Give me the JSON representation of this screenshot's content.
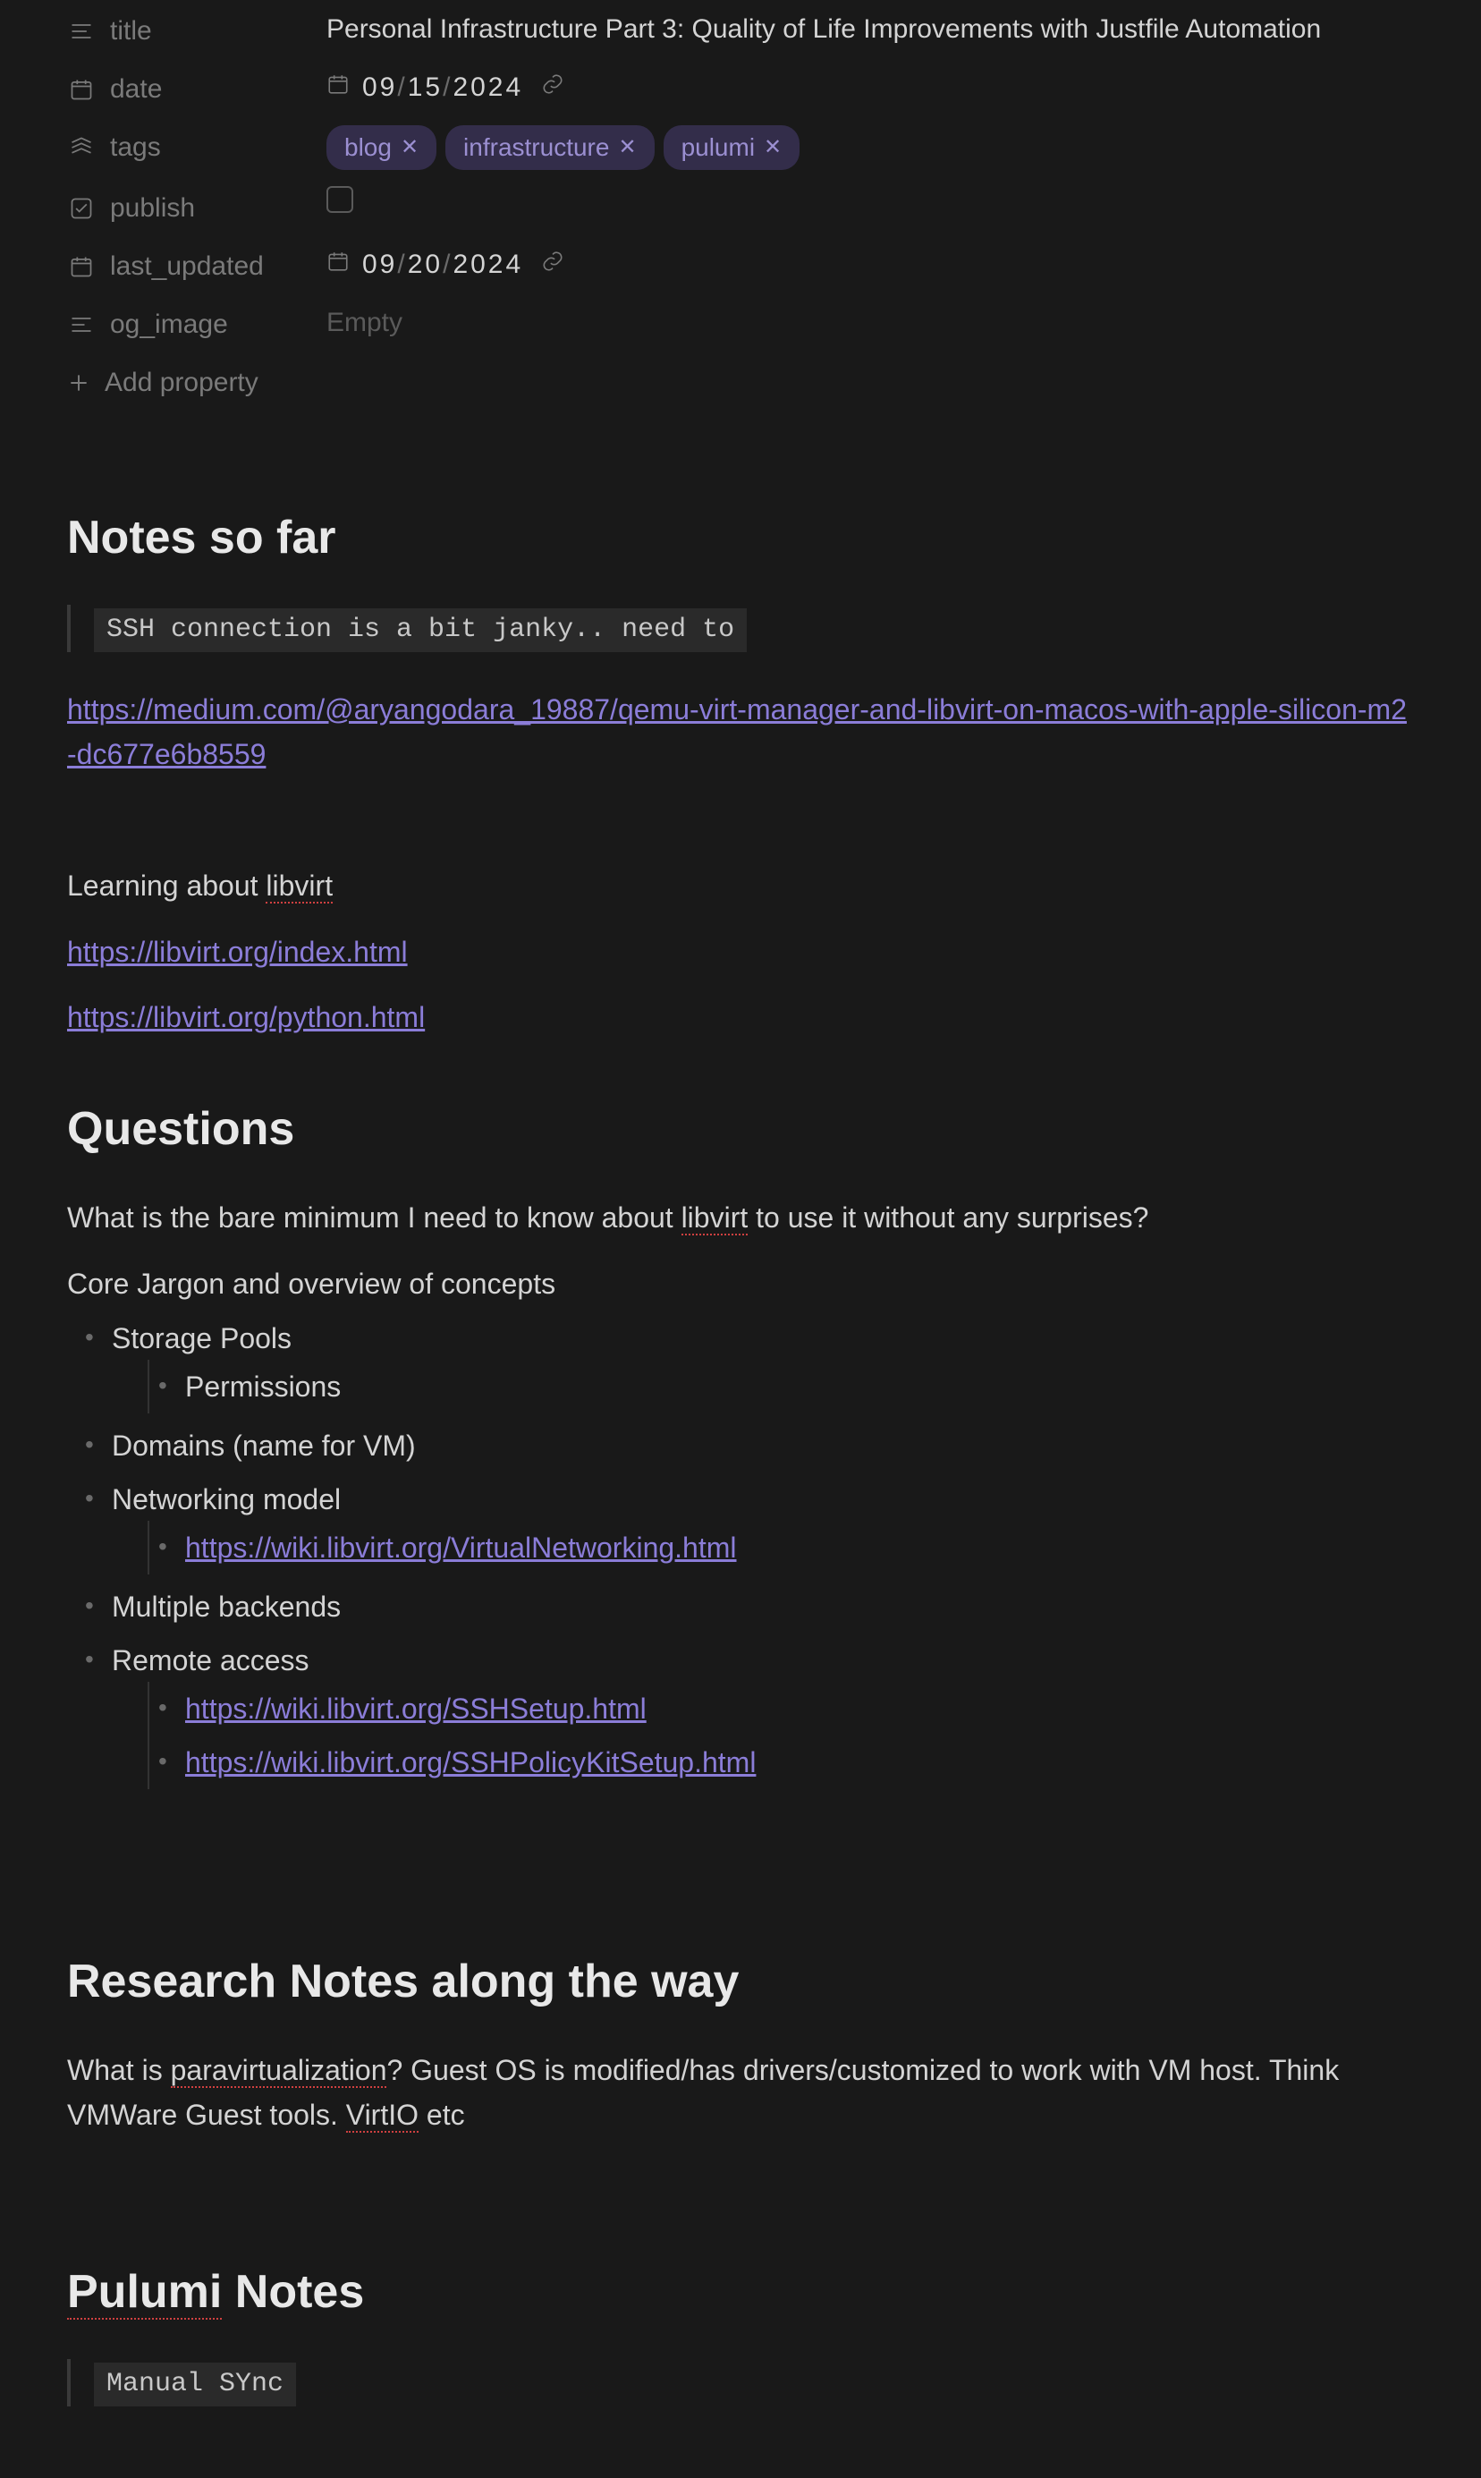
{
  "properties": {
    "title": {
      "label": "title",
      "value": "Personal Infrastructure Part 3: Quality of Life Improvements with Justfile Automation"
    },
    "date": {
      "label": "date",
      "month": "09",
      "day": "15",
      "year": "2024"
    },
    "tags": {
      "label": "tags",
      "items": [
        "blog",
        "infrastructure",
        "pulumi"
      ]
    },
    "publish": {
      "label": "publish",
      "checked": false
    },
    "last_updated": {
      "label": "last_updated",
      "month": "09",
      "day": "20",
      "year": "2024"
    },
    "og_image": {
      "label": "og_image",
      "value": "Empty"
    },
    "add_property": "Add property"
  },
  "headings": {
    "notes": "Notes so far",
    "questions": "Questions",
    "research": "Research Notes along the way",
    "pulumi": "Pulumi Notes"
  },
  "snippets": {
    "ssh": "SSH connection is a bit janky.. need to ",
    "manual_sync": "Manual SYnc"
  },
  "text": {
    "learning_prefix": "Learning about ",
    "learning_spell": "libvirt",
    "q1_a": "What is the bare minimum I need to know about ",
    "q1_spell": "libvirt",
    "q1_b": " to use it without any surprises?",
    "core": "Core Jargon and overview of concepts",
    "research_a": "What is ",
    "research_spell1": "paravirtualization",
    "research_b": "? Guest OS is modified/has drivers/customized to work with VM host. Think VMWare Guest tools. ",
    "research_spell2": "VirtIO",
    "research_c": " etc",
    "pulumi_title_spell": "Pulumi",
    "pulumi_title_rest": " Notes"
  },
  "links": {
    "medium": "https://medium.com/@aryangodara_19887/qemu-virt-manager-and-libvirt-on-macos-with-apple-silicon-m2-dc677e6b8559",
    "libvirt_index": "https://libvirt.org/index.html",
    "libvirt_python": "https://libvirt.org/python.html",
    "virt_net": "https://wiki.libvirt.org/VirtualNetworking.html",
    "ssh_setup": "https://wiki.libvirt.org/SSHSetup.html",
    "ssh_polkit": "https://wiki.libvirt.org/SSHPolicyKitSetup.html"
  },
  "bullets": {
    "storage_pools": "Storage Pools",
    "permissions": "Permissions",
    "domains": "Domains (name for VM)",
    "networking": "Networking model",
    "multiple_backends": "Multiple backends",
    "remote_access": "Remote access"
  }
}
